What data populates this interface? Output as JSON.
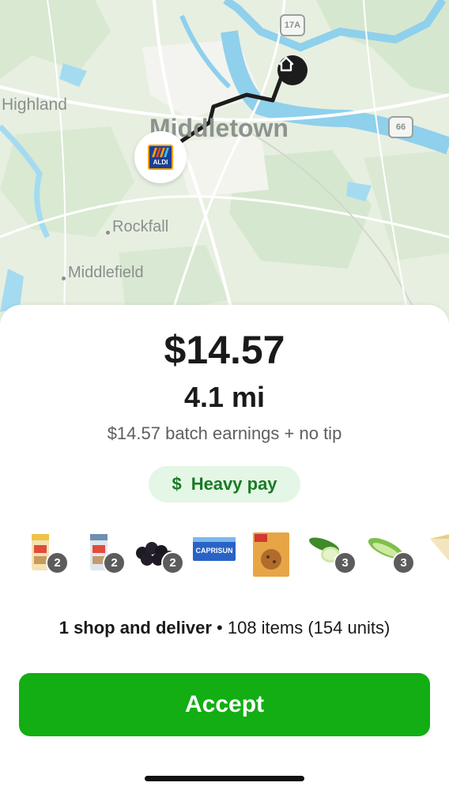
{
  "map": {
    "places": {
      "highland": "Highland",
      "middletown": "Middletown",
      "rockfall": "Rockfall",
      "middlefield": "Middlefield"
    },
    "route_shields": {
      "r17a": "17A",
      "r66": "66"
    },
    "store_logo_text": "ALDI",
    "store_icon": "aldi-store-icon",
    "home_icon": "home-icon"
  },
  "offer": {
    "price": "$14.57",
    "distance": "4.1 mi",
    "earnings_note": "$14.57 batch earnings + no tip",
    "pay_badge": {
      "icon_text": "$",
      "label": "Heavy pay"
    }
  },
  "items": [
    {
      "name": "snack-bar",
      "count": "2"
    },
    {
      "name": "snack-bar-2",
      "count": "2"
    },
    {
      "name": "blackberries",
      "count": "2"
    },
    {
      "name": "capri-sun-box",
      "count": null
    },
    {
      "name": "cookie-box",
      "count": null
    },
    {
      "name": "cucumbers",
      "count": "3"
    },
    {
      "name": "romaine-lettuce",
      "count": "3"
    },
    {
      "name": "cheese-wedge",
      "count": null
    }
  ],
  "item_labels": {
    "capri_sun": "CAPRISUN"
  },
  "summary": {
    "type": "1 shop and deliver",
    "separator": "•",
    "details": "108 items (154 units)"
  },
  "accept_button": {
    "label": "Accept"
  },
  "colors": {
    "accent": "#12ae13",
    "pill_bg": "#e4f6e5",
    "pill_text": "#1a7a25"
  }
}
